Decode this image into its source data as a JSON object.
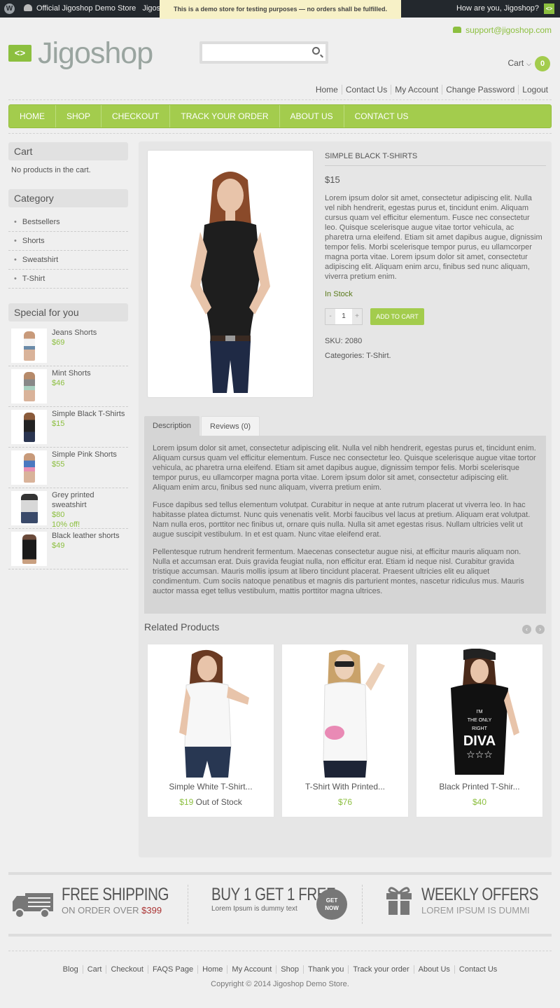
{
  "adminbar": {
    "site_name": "Official Jigoshop Demo Store",
    "site_name_extra": "Jigosh",
    "notice": "This is a demo store for testing purposes — no orders shall be fulfilled.",
    "greeting": "How are you, Jigoshop?"
  },
  "header": {
    "support_email": "support@jigoshop.com",
    "logo_text": "Jigoshop",
    "logo_mark": "<>",
    "search_placeholder": "",
    "cart_label": "Cart",
    "cart_count": "0",
    "top_links": [
      "Home",
      "Contact Us",
      "My Account",
      "Change Password",
      "Logout"
    ]
  },
  "nav": {
    "items": [
      "HOME",
      "SHOP",
      "CHECKOUT",
      "TRACK YOUR ORDER",
      "ABOUT US",
      "CONTACT US"
    ]
  },
  "sidebar": {
    "cart_title": "Cart",
    "cart_empty": "No products in the cart.",
    "category_title": "Category",
    "categories": [
      "Bestsellers",
      "Shorts",
      "Sweatshirt",
      "T-Shirt"
    ],
    "special_title": "Special for you",
    "special": [
      {
        "name": "Jeans Shorts",
        "price": "$69",
        "note": ""
      },
      {
        "name": "Mint Shorts",
        "price": "$46",
        "note": ""
      },
      {
        "name": "Simple Black T-Shirts",
        "price": "$15",
        "note": ""
      },
      {
        "name": "Simple Pink Shorts",
        "price": "$55",
        "note": ""
      },
      {
        "name": "Grey printed sweatshirt",
        "price": "$80",
        "note": "10% off!"
      },
      {
        "name": "Black leather shorts",
        "price": "$49",
        "note": ""
      }
    ]
  },
  "product": {
    "title": "SIMPLE BLACK T-SHIRTS",
    "price": "$15",
    "description": "Lorem ipsum dolor sit amet, consectetur adipiscing elit. Nulla vel nibh hendrerit, egestas purus et, tincidunt enim. Aliquam cursus quam vel efficitur elementum. Fusce nec consectetur leo. Quisque scelerisque augue vitae tortor vehicula, ac pharetra urna eleifend. Etiam sit amet dapibus augue, dignissim tempor felis. Morbi scelerisque tempor purus, eu ullamcorper magna porta vitae. Lorem ipsum dolor sit amet, consectetur adipiscing elit. Aliquam enim arcu, finibus sed nunc aliquam, viverra pretium enim.",
    "stock": "In Stock",
    "qty": "1",
    "qty_minus": "-",
    "qty_plus": "+",
    "add_to_cart": "ADD TO CART",
    "sku": "SKU: 2080",
    "categories": "Categories: T-Shirt."
  },
  "tabs": {
    "description_label": "Description",
    "reviews_label": "Reviews (0)",
    "paragraphs": [
      "Lorem ipsum dolor sit amet, consectetur adipiscing elit. Nulla vel nibh hendrerit, egestas purus et, tincidunt enim. Aliquam cursus quam vel efficitur elementum. Fusce nec consectetur leo. Quisque scelerisque augue vitae tortor vehicula, ac pharetra urna eleifend. Etiam sit amet dapibus augue, dignissim tempor felis. Morbi scelerisque tempor purus, eu ullamcorper magna porta vitae. Lorem ipsum dolor sit amet, consectetur adipiscing elit. Aliquam enim arcu, finibus sed nunc aliquam, viverra pretium enim.",
      "Fusce dapibus sed tellus elementum volutpat. Curabitur in neque at ante rutrum placerat ut viverra leo. In hac habitasse platea dictumst. Nunc quis venenatis velit. Morbi faucibus vel lacus at pretium. Aliquam erat volutpat. Nam nulla eros, porttitor nec finibus ut, ornare quis nulla. Nulla sit amet egestas risus. Nullam ultricies velit ut augue suscipit vestibulum. In et est quam. Nunc vitae eleifend erat.",
      "Pellentesque rutrum hendrerit fermentum. Maecenas consectetur augue nisi, at efficitur mauris aliquam non. Nulla et accumsan erat. Duis gravida feugiat nulla, non efficitur erat. Etiam id neque nisl. Curabitur gravida tristique accumsan. Mauris mollis ipsum at libero tincidunt placerat. Praesent ultricies elit eu aliquet condimentum. Cum sociis natoque penatibus et magnis dis parturient montes, nascetur ridiculus mus. Mauris auctor massa eget tellus vestibulum, mattis porttitor magna ultrices."
    ]
  },
  "related": {
    "title": "Related Products",
    "items": [
      {
        "name": "Simple White T-Shirt...",
        "price": "$19",
        "status": "Out of Stock"
      },
      {
        "name": "T-Shirt With Printed...",
        "price": "$76",
        "status": ""
      },
      {
        "name": "Black Printed T-Shir...",
        "price": "$40",
        "status": ""
      }
    ]
  },
  "banner": {
    "shipping_title": "FREE SHIPPING",
    "shipping_sub": "ON ORDER OVER",
    "shipping_amount": "$399",
    "bogo_title": "BUY 1 GET 1 FREE",
    "bogo_sub": "Lorem Ipsum is dummy text",
    "getnow_line1": "GET",
    "getnow_line2": "NOW",
    "weekly_title": "WEEKLY OFFERS",
    "weekly_sub": "LOREM IPSUM IS DUMMI"
  },
  "footer": {
    "links": [
      "Blog",
      "Cart",
      "Checkout",
      "FAQS Page",
      "Home",
      "My Account",
      "Shop",
      "Thank you",
      "Track your order",
      "About Us",
      "Contact Us"
    ],
    "copyright": "Copyright © 2014 Jigoshop Demo Store."
  },
  "colors": {
    "accent": "#a3cc4d",
    "admin_bar": "#23282d",
    "notice_bg": "#f7f1c7",
    "price": "#8cbf3f"
  },
  "icons": [
    "wordpress-icon",
    "dashboard-icon",
    "avatar-icon",
    "phone-icon",
    "search-icon",
    "chevron-down-icon",
    "prev-arrow-icon",
    "next-arrow-icon",
    "truck-icon",
    "gift-icon"
  ]
}
